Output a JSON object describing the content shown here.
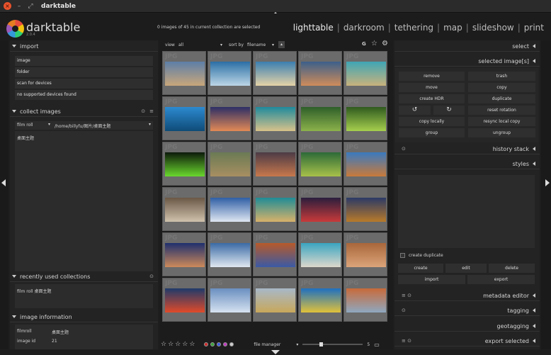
{
  "window": {
    "title": "darktable"
  },
  "header": {
    "brand": "darktable",
    "version": "2.0.4",
    "status": "0 images of 45 in current collection are selected",
    "views": [
      "lighttable",
      "darkroom",
      "tethering",
      "map",
      "slideshow",
      "print"
    ],
    "separator": "|"
  },
  "left": {
    "import": {
      "title": "import",
      "items": [
        "image",
        "folder",
        "scan for devices",
        "no supported devices found"
      ]
    },
    "collect": {
      "title": "collect images",
      "property": "film roll",
      "path": "/home/billyfu/图片/桌面主题",
      "entry": "桌面主题"
    },
    "recent": {
      "title": "recently used collections",
      "entry": "film roll 桌面主题"
    },
    "info": {
      "title": "image information",
      "rows": [
        {
          "k": "filmroll",
          "v": "桌面主题"
        },
        {
          "k": "image id",
          "v": "21"
        }
      ]
    }
  },
  "center": {
    "view_label": "view",
    "view_value": "all",
    "sort_label": "sort by",
    "sort_value": "filename",
    "layout_value": "file manager",
    "zoom_value": "5",
    "grouping_label": "G",
    "ghost_text": "JPG",
    "thumbnails": [
      [
        "#5d7ea8",
        "#c9a77a"
      ],
      [
        "#2b6fa5",
        "#bcd6e6"
      ],
      [
        "#3a7fb0",
        "#e5d3a8"
      ],
      [
        "#3b5f8a",
        "#d08c5a"
      ],
      [
        "#3fa6b5",
        "#c8b27c"
      ],
      [
        "#2c8ad0",
        "#0f4b77"
      ],
      [
        "#2d2f66",
        "#e38a55"
      ],
      [
        "#1f8a9c",
        "#d8c28a"
      ],
      [
        "#2f5f2a",
        "#8cb24a"
      ],
      [
        "#2f5a1f",
        "#a6d04d"
      ],
      [
        "#0d1a0a",
        "#6ad82e"
      ],
      [
        "#6a7a54",
        "#a88f62"
      ],
      [
        "#4c3b46",
        "#c8784c"
      ],
      [
        "#2d6a38",
        "#a8c24a"
      ],
      [
        "#3a7ac0",
        "#c87a3a"
      ],
      [
        "#6b5846",
        "#cfc2ad"
      ],
      [
        "#2f5fa5",
        "#dfe7f2"
      ],
      [
        "#1f8c96",
        "#d8b26a"
      ],
      [
        "#2b1e3d",
        "#c83a3a"
      ],
      [
        "#2b3a66",
        "#b87a2a"
      ],
      [
        "#1e2f6e",
        "#cd8a5a"
      ],
      [
        "#3a6aa5",
        "#e0e8f0"
      ],
      [
        "#b85a2a",
        "#3a5aa5"
      ],
      [
        "#3aa5c0",
        "#ddd8cc"
      ],
      [
        "#a8663a",
        "#dca47a"
      ],
      [
        "#1f3a6a",
        "#e04a2a"
      ],
      [
        "#6a8fc0",
        "#d6e2f0"
      ],
      [
        "#a8b8c8",
        "#c8a85a"
      ],
      [
        "#1e70c0",
        "#e0c23a"
      ],
      [
        "#c86a3a",
        "#8ea8c0"
      ]
    ],
    "star_glyph": "☆",
    "color_labels": [
      "#cc2a2a",
      "#3aa53a",
      "#3a5ae0",
      "#c03ac0",
      "#cccccc"
    ]
  },
  "right": {
    "select": {
      "title": "select"
    },
    "selected": {
      "title": "selected image[s]",
      "buttons": [
        "remove",
        "trash",
        "move",
        "copy",
        "create HDR",
        "duplicate",
        "↺",
        "↻",
        "reset rotation",
        "copy locally",
        "resync local copy",
        "group",
        "ungroup"
      ]
    },
    "history": {
      "title": "history stack"
    },
    "styles": {
      "title": "styles",
      "checkbox_label": "create duplicate",
      "buttons": [
        "create",
        "edit",
        "delete",
        "import",
        "export"
      ]
    },
    "metadata": {
      "title": "metadata editor"
    },
    "tagging": {
      "title": "tagging"
    },
    "geotagging": {
      "title": "geotagging"
    },
    "export": {
      "title": "export selected"
    }
  }
}
